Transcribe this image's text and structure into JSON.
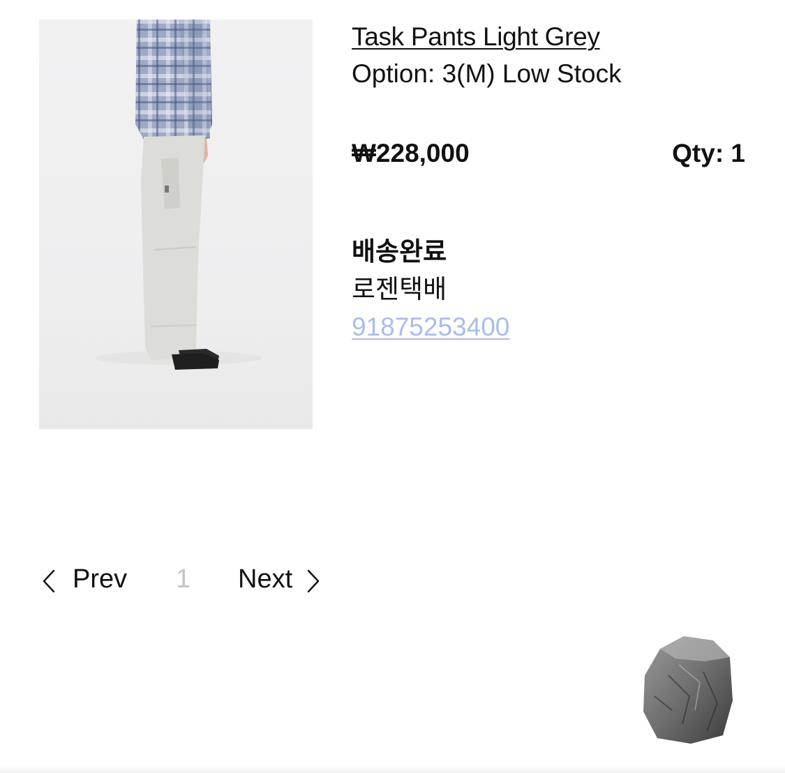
{
  "product": {
    "name": "Task Pants Light Grey",
    "option": "Option: 3(M) Low Stock",
    "price": "₩228,000",
    "quantity": "Qty: 1",
    "image_icon": "product-photo"
  },
  "shipping": {
    "status": "배송완료",
    "carrier": "로젠택배",
    "tracking_number": "91875253400",
    "tracking_color": "#a9bde6"
  },
  "pagination": {
    "prev_label": "Prev",
    "current_page": "1",
    "next_label": "Next",
    "prev_icon": "chevron-left-icon",
    "next_icon": "chevron-right-icon"
  },
  "decor": {
    "rock_icon": "rock-icon"
  }
}
